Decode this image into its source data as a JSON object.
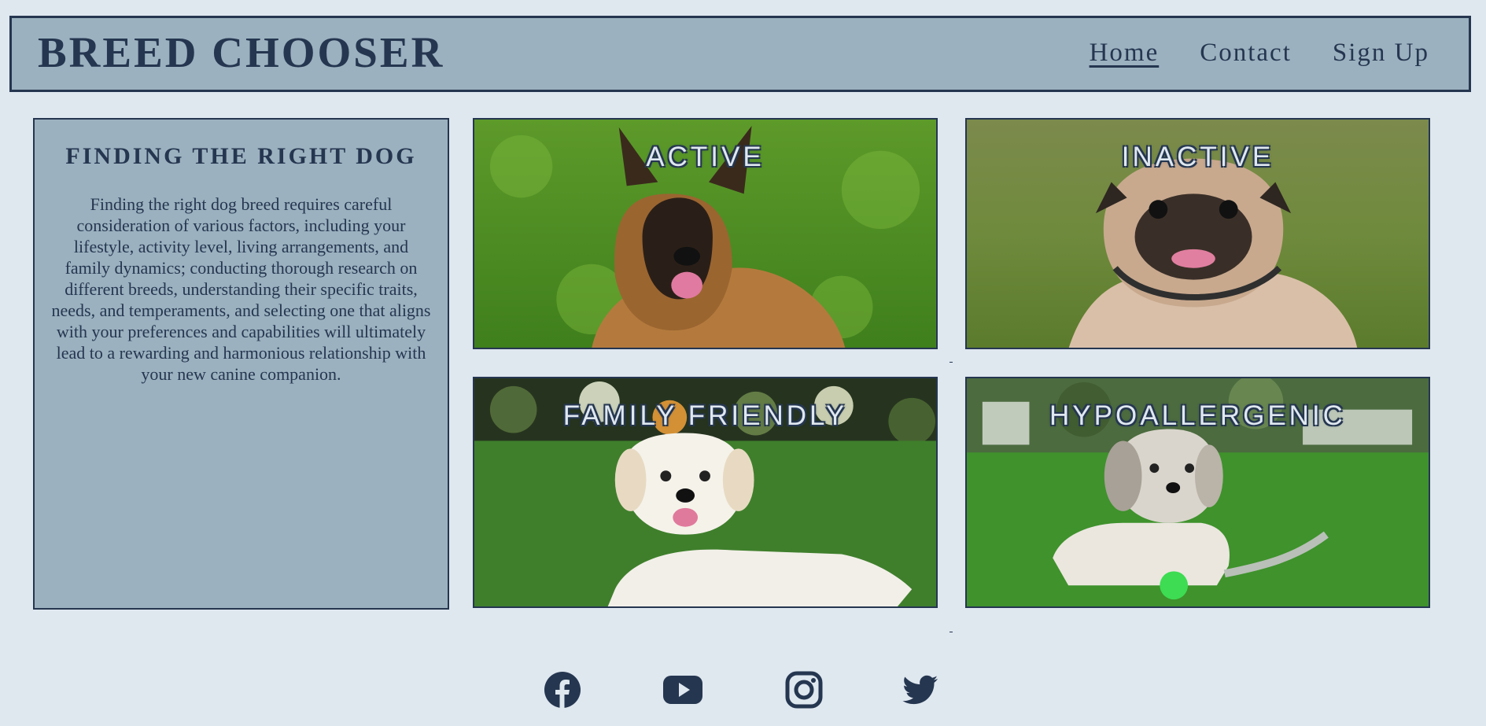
{
  "header": {
    "brand": "BREED CHOOSER",
    "nav": [
      {
        "label": "Home",
        "active": true
      },
      {
        "label": "Contact",
        "active": false
      },
      {
        "label": "Sign Up",
        "active": false
      }
    ]
  },
  "info": {
    "title": "FINDING THE RIGHT DOG",
    "body": "Finding the right dog breed requires careful consideration of various factors, including your lifestyle, activity level, living arrangements, and family dynamics; conducting thorough research on different breeds, understanding their specific traits, needs, and temperaments, and selecting one that aligns with your preferences and capabilities will ultimately lead to a rewarding and harmonious relationship with your new canine companion."
  },
  "categories": [
    {
      "label": "ACTIVE",
      "image": "belgian-malinois-on-grass"
    },
    {
      "label": "INACTIVE",
      "image": "pug-on-grass"
    },
    {
      "label": "FAMILY FRIENDLY",
      "image": "golden-retriever-on-lawn"
    },
    {
      "label": "HYPOALLERGENIC",
      "image": "shih-tzu-with-rope-toy"
    }
  ],
  "footer": {
    "social_icons": [
      "facebook-icon",
      "youtube-icon",
      "instagram-icon",
      "twitter-icon"
    ]
  },
  "colors": {
    "page_background": "#dfe7ef",
    "panel": "#9bb1bf",
    "navy": "#253650"
  }
}
